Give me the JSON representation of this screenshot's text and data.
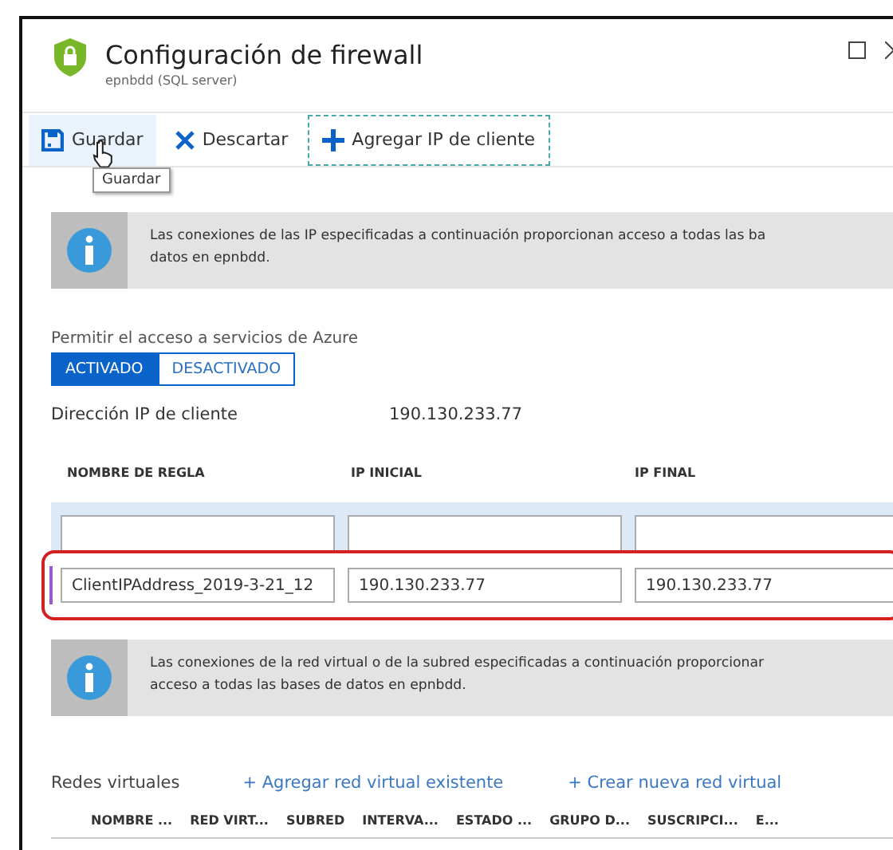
{
  "header": {
    "title": "Configuración de firewall",
    "subtitle": "epnbdd (SQL server)"
  },
  "toolbar": [
    {
      "label": "Guardar",
      "kind": "save",
      "hovered": true
    },
    {
      "label": "Descartar",
      "kind": "discard",
      "hovered": false
    },
    {
      "label": "Agregar IP de cliente",
      "kind": "add",
      "hovered": false
    }
  ],
  "tooltip": "Guardar",
  "info_top": [
    "Las conexiones de las IP especificadas a continuación proporcionan acceso a todas las ba",
    "datos en epnbdd."
  ],
  "azure_access": {
    "label": "Permitir el acceso a servicios de Azure",
    "options": [
      {
        "label": "ACTIVADO",
        "selected": true
      },
      {
        "label": "DESACTIVADO",
        "selected": false
      }
    ]
  },
  "client_ip": {
    "label": "Dirección IP de cliente",
    "value": "190.130.233.77"
  },
  "rules": {
    "columns": [
      "NOMBRE DE REGLA",
      "IP INICIAL",
      "IP FINAL"
    ],
    "rows": [
      [
        "ClientIPAddress_2019-3-21_12",
        "190.130.233.77",
        "190.130.233.77"
      ]
    ]
  },
  "info_vnet": [
    "Las conexiones de la red virtual o de la subred especificadas a continuación proporcionar",
    "acceso a todas las bases de datos en epnbdd."
  ],
  "vnets": {
    "label": "Redes virtuales",
    "links": [
      "+ Agregar red virtual existente",
      "+ Crear nueva red virtual"
    ],
    "columns": [
      "NOMBRE ...",
      "RED VIRT...",
      "SUBRED",
      "INTERVA...",
      "ESTADO ...",
      "GRUPO D...",
      "SUSCRIPCI...",
      "E..."
    ]
  }
}
